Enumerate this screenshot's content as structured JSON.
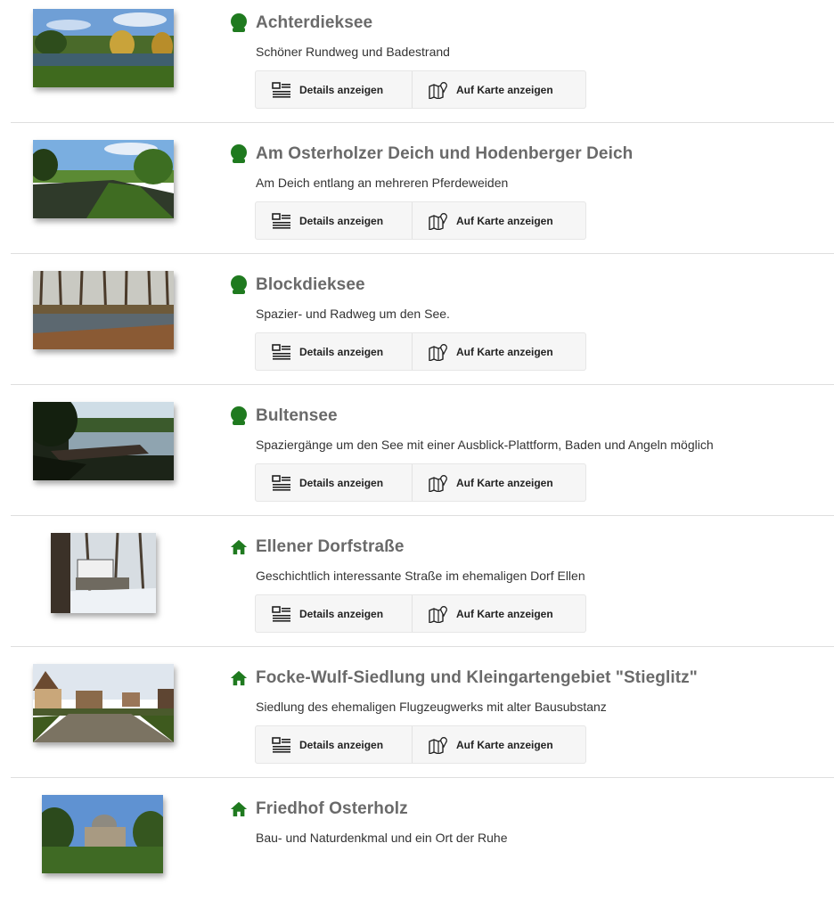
{
  "buttons": {
    "details_label": "Details anzeigen",
    "map_label": "Auf Karte anzeigen"
  },
  "colors": {
    "icon_green": "#1f7a1f",
    "title_gray": "#6a6a6a",
    "divider": "#dedede"
  },
  "items": [
    {
      "type_icon": "tree-icon",
      "title": "Achterdieksee",
      "description": "Schöner Rundweg und Badestrand"
    },
    {
      "type_icon": "tree-icon",
      "title": "Am Osterholzer Deich und Hodenberger Deich",
      "description": "Am Deich entlang an mehreren Pferdeweiden"
    },
    {
      "type_icon": "tree-icon",
      "title": "Blockdieksee",
      "description": "Spazier- und Radweg um den See."
    },
    {
      "type_icon": "tree-icon",
      "title": "Bultensee",
      "description": "Spaziergänge um den See mit einer Ausblick-Plattform, Baden und Angeln möglich"
    },
    {
      "type_icon": "house-icon",
      "title": "Ellener Dorfstraße",
      "description": "Geschichtlich interessante Straße im ehemaligen Dorf Ellen"
    },
    {
      "type_icon": "house-icon",
      "title": "Focke-Wulf-Siedlung und Kleingartengebiet \"Stieglitz\"",
      "description": "Siedlung des ehemaligen Flugzeugwerks mit alter Bausubstanz"
    },
    {
      "type_icon": "house-icon",
      "title": "Friedhof Osterholz",
      "description": "Bau- und Naturdenkmal und ein Ort der Ruhe"
    }
  ]
}
